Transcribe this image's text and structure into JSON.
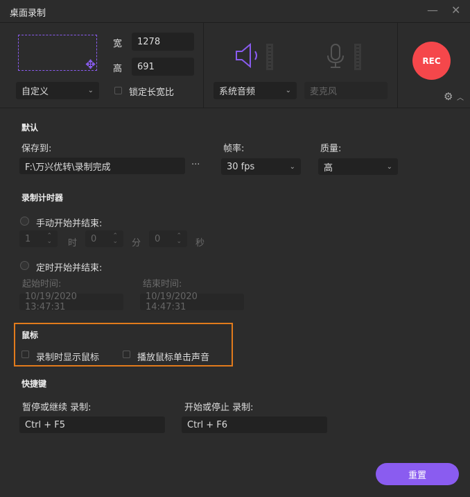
{
  "window": {
    "title": "桌面录制",
    "minimize": "—",
    "close": "✕"
  },
  "capture": {
    "width_label": "宽",
    "width": "1278",
    "height_label": "高",
    "height": "691",
    "preset": "自定义",
    "lock_ratio": "锁定长宽比"
  },
  "audio": {
    "system": "系统音频",
    "mic": "麦克风"
  },
  "rec_label": "REC",
  "defaults": {
    "title": "默认",
    "save_to_label": "保存到:",
    "save_path": "F:\\万兴优转\\录制完成",
    "browse": "···",
    "fps_label": "帧率:",
    "fps": "30 fps",
    "quality_label": "质量:",
    "quality": "高"
  },
  "timer": {
    "title": "录制计时器",
    "manual": "手动开始并结束:",
    "hours": "1",
    "h_unit": "时",
    "minutes": "0",
    "m_unit": "分",
    "seconds": "0",
    "s_unit": "秒",
    "scheduled": "定时开始并结束:",
    "start_label": "起始时间:",
    "start": "10/19/2020 13:47:31",
    "end_label": "结束时间:",
    "end": "10/19/2020 14:47:31"
  },
  "mouse": {
    "title": "鼠标",
    "show_cursor": "录制时显示鼠标",
    "click_sound": "播放鼠标单击声音"
  },
  "hotkeys": {
    "title": "快捷键",
    "pause_label": "暂停或继续 录制:",
    "pause": "Ctrl + F5",
    "start_label": "开始或停止 录制:",
    "start": "Ctrl + F6"
  },
  "reset": "重置"
}
